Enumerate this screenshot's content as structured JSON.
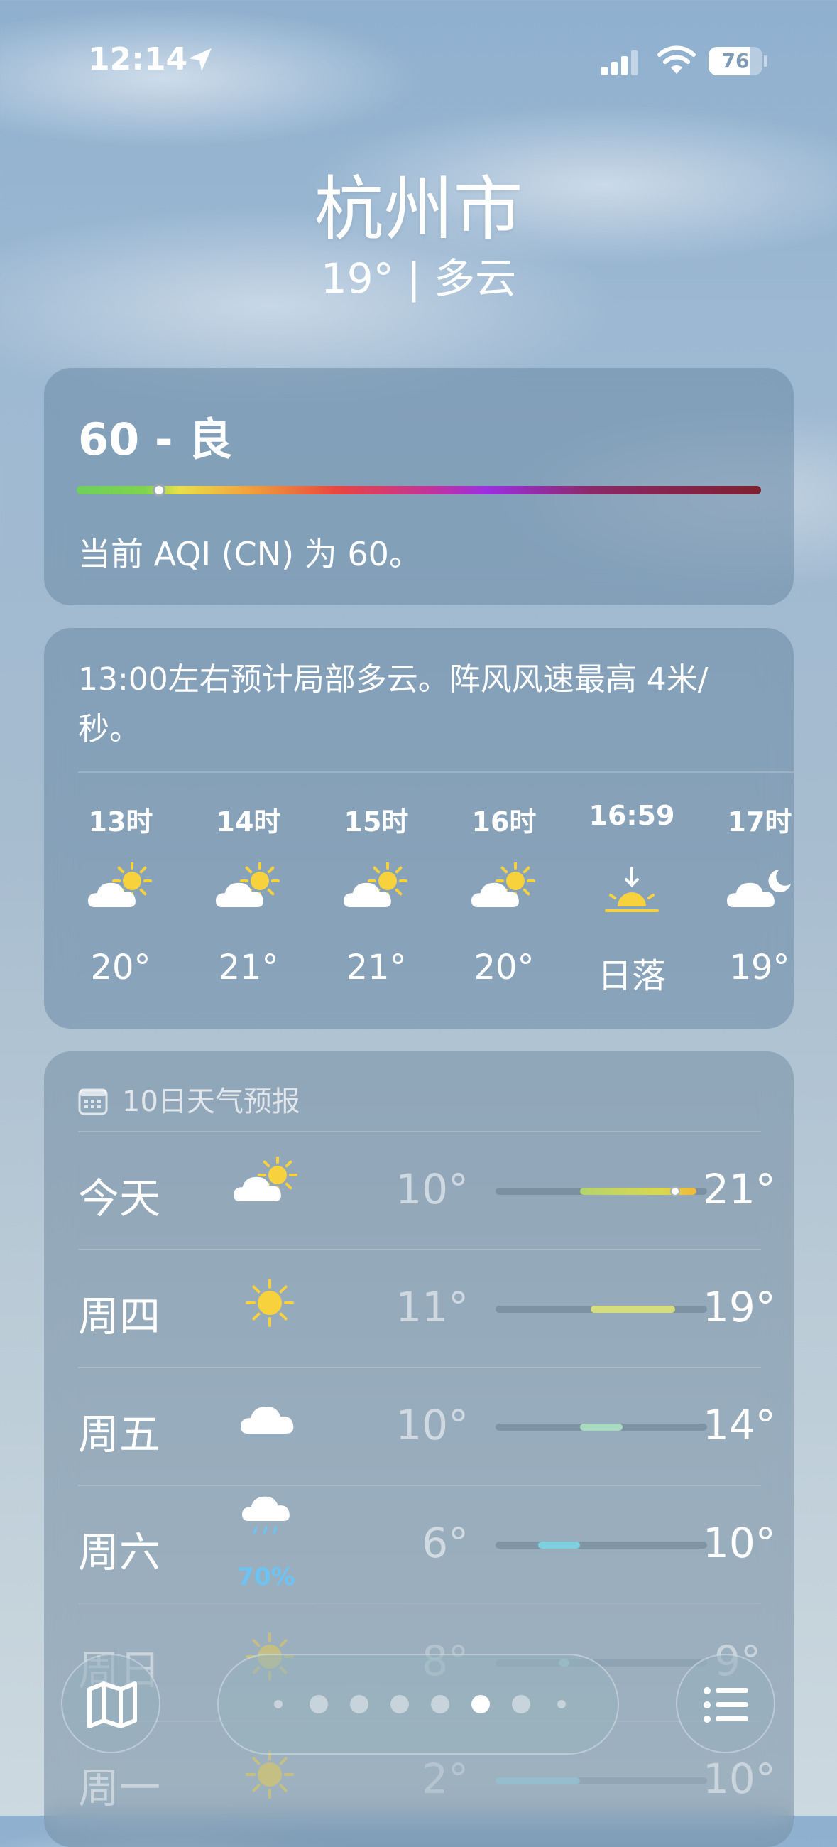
{
  "status_bar": {
    "time": "12:14",
    "battery": "76",
    "battery_level": 0.76
  },
  "header": {
    "city": "杭州市",
    "current": "19° | 多云"
  },
  "aqi": {
    "value_label": "60 - 良",
    "description": "当前 AQI (CN) 为 60。",
    "value": 60
  },
  "hourly": {
    "summary": "13:00左右预计局部多云。阵风风速最高 4米/秒。",
    "items": [
      {
        "time": "13时",
        "icon": "partly-cloudy-sun-icon",
        "temp": "20°"
      },
      {
        "time": "14时",
        "icon": "partly-cloudy-sun-icon",
        "temp": "21°"
      },
      {
        "time": "15时",
        "icon": "partly-cloudy-sun-icon",
        "temp": "21°"
      },
      {
        "time": "16时",
        "icon": "partly-cloudy-sun-icon",
        "temp": "20°"
      },
      {
        "time": "16:59",
        "icon": "sunset-icon",
        "temp": "日落"
      },
      {
        "time": "17时",
        "icon": "partly-cloudy-moon-icon",
        "temp": "19°"
      }
    ]
  },
  "daily": {
    "title": "10日天气预报",
    "days": [
      {
        "day": "今天",
        "icon": "partly-cloudy-sun-icon",
        "low": "10°",
        "high": "21°",
        "precip": "",
        "low_value": 10,
        "high_value": 21,
        "current_value": 19,
        "bar_color": "#c7d765"
      },
      {
        "day": "周四",
        "icon": "sun-icon",
        "low": "11°",
        "high": "19°",
        "precip": "",
        "low_value": 11,
        "high_value": 19,
        "bar_color": "#d6dd7e"
      },
      {
        "day": "周五",
        "icon": "cloud-icon",
        "low": "10°",
        "high": "14°",
        "precip": "",
        "low_value": 10,
        "high_value": 14,
        "bar_color": "#a8dac0"
      },
      {
        "day": "周六",
        "icon": "rain-cloud-icon",
        "low": "6°",
        "high": "10°",
        "precip": "70%",
        "low_value": 6,
        "high_value": 10,
        "bar_color": "#7fd0de"
      },
      {
        "day": "周日",
        "icon": "sun-icon",
        "low": "8°",
        "high": "9°",
        "precip": "",
        "low_value": 8,
        "high_value": 9,
        "bar_color": "#9ad6d0"
      },
      {
        "day": "周一",
        "icon": "sun-icon",
        "low": "2°",
        "high": "10°",
        "precip": "",
        "low_value": 2,
        "high_value": 10,
        "bar_color": "#8ccde0"
      }
    ],
    "range_min": 2,
    "range_max": 22
  },
  "toolbar": {
    "page_count": 8,
    "active_page": 5
  }
}
